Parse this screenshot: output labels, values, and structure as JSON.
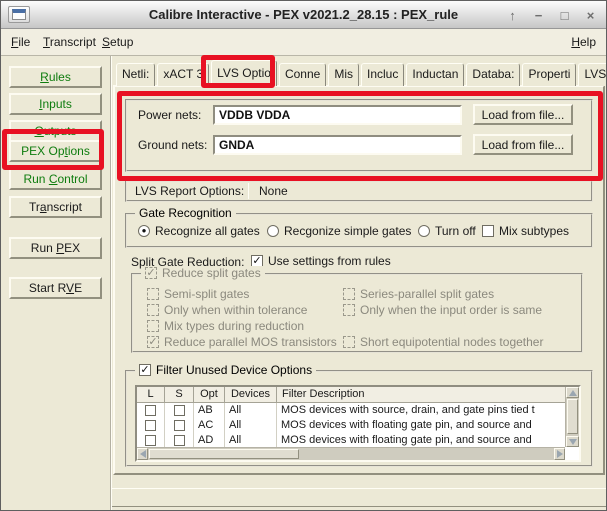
{
  "window": {
    "title": "Calibre Interactive - PEX v2021.2_28.15 : PEX_rule",
    "controls": {
      "shade": "↑",
      "minimize": "−",
      "maximize": "□",
      "close": "×"
    }
  },
  "menu": {
    "file": "File",
    "transcript": "Transcript",
    "setup": "Setup",
    "help": "Help"
  },
  "sidebar": {
    "buttons": [
      {
        "label": "Rules"
      },
      {
        "label": "Inputs"
      },
      {
        "label": "Outputs"
      },
      {
        "label": "PEX Options"
      },
      {
        "label": "Run Control"
      },
      {
        "label": "Transcript"
      },
      {
        "label": "Run PEX"
      },
      {
        "label": "Start RVE"
      }
    ]
  },
  "tabs": [
    "Netli:",
    "xACT 3",
    "LVS Optio",
    "Conne",
    "Mis",
    "Incluc",
    "Inductan",
    "Databa:",
    "Properti",
    "LVS B"
  ],
  "nets": {
    "power_label": "Power nets:",
    "power_value": "VDDB VDDA",
    "ground_label": "Ground nets:",
    "ground_value": "GNDA",
    "load_button": "Load from file..."
  },
  "lvs_report": {
    "label": "LVS Report Options:",
    "value": "None"
  },
  "gate_recognition": {
    "title": "Gate Recognition",
    "radio_all": {
      "label": "Recognize all gates",
      "dot": "●"
    },
    "radio_simple": {
      "label": "Recgonize simple gates",
      "dot": ""
    },
    "radio_off": {
      "label": "Turn off",
      "dot": ""
    },
    "mix": {
      "label": "Mix subtypes",
      "check": ""
    }
  },
  "split_gate": {
    "label": "Split Gate Reduction:",
    "use_settings": {
      "label": "Use settings from rules",
      "check": "✓"
    },
    "group_title": {
      "label": "Reduce split gates",
      "check": "✓"
    },
    "left": [
      {
        "label": "Semi-split gates",
        "check": ""
      },
      {
        "label": "Only when within tolerance",
        "check": ""
      },
      {
        "label": "Mix types during reduction",
        "check": ""
      },
      {
        "label": "Reduce parallel MOS transistors",
        "check": "✓"
      }
    ],
    "right": [
      {
        "label": "Series-parallel split gates",
        "check": ""
      },
      {
        "label": "Only when the input order is same",
        "check": ""
      },
      {
        "label": "Short equipotential nodes together",
        "check": ""
      }
    ]
  },
  "filter_devices": {
    "title": {
      "label": "Filter Unused Device Options",
      "check": "✓"
    },
    "headers": [
      "L",
      "S",
      "Opt",
      "Devices",
      "Filter Description"
    ],
    "rows": [
      {
        "l": "",
        "s": "",
        "opt": "AB",
        "devices": "All",
        "description": "MOS devices with source, drain, and gate pins tied t"
      },
      {
        "l": "",
        "s": "",
        "opt": "AC",
        "devices": "All",
        "description": "MOS devices with floating gate pin, and source and"
      },
      {
        "l": "",
        "s": "",
        "opt": "AD",
        "devices": "All",
        "description": "MOS devices with floating gate pin, and source and"
      }
    ]
  },
  "colors": {
    "annotation_red": "#e81123",
    "accent_green": "#0e7c0e",
    "background": "#ece9d6"
  }
}
